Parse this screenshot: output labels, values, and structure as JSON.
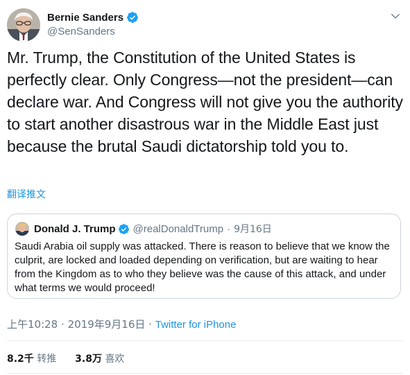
{
  "author": {
    "name": "Bernie Sanders",
    "handle": "@SenSanders"
  },
  "tweet": {
    "text": "Mr. Trump, the Constitution of the United States is perfectly clear. Only Congress—not the president—can declare war. And Congress will not give you the authority to start another disastrous war in the Middle East just because the brutal Saudi dictatorship told you to.",
    "translate_label": "翻译推文"
  },
  "quoted": {
    "name": "Donald J. Trump",
    "handle": "@realDonaldTrump",
    "separator": "·",
    "date": "9月16日",
    "text": "Saudi Arabia oil supply was attacked. There is reason to believe that we know the culprit, are locked and loaded depending on verification, but are waiting to hear from the Kingdom as to who they believe was the cause of this attack, and under what terms we would proceed!"
  },
  "meta": {
    "time": "上午10:28",
    "separator": "·",
    "date": "2019年9月16日",
    "separator2": "·",
    "source": "Twitter for iPhone"
  },
  "stats": {
    "retweets_count": "8.2千",
    "retweets_label": "转推",
    "likes_count": "3.8万",
    "likes_label": "喜欢"
  },
  "colors": {
    "accent": "#1b95e0",
    "verified": "#1da1f2",
    "secondary_text": "#657786",
    "border": "#ccd6dd"
  },
  "icons": {
    "verified": "verified-badge-icon",
    "caret": "chevron-down-icon"
  }
}
